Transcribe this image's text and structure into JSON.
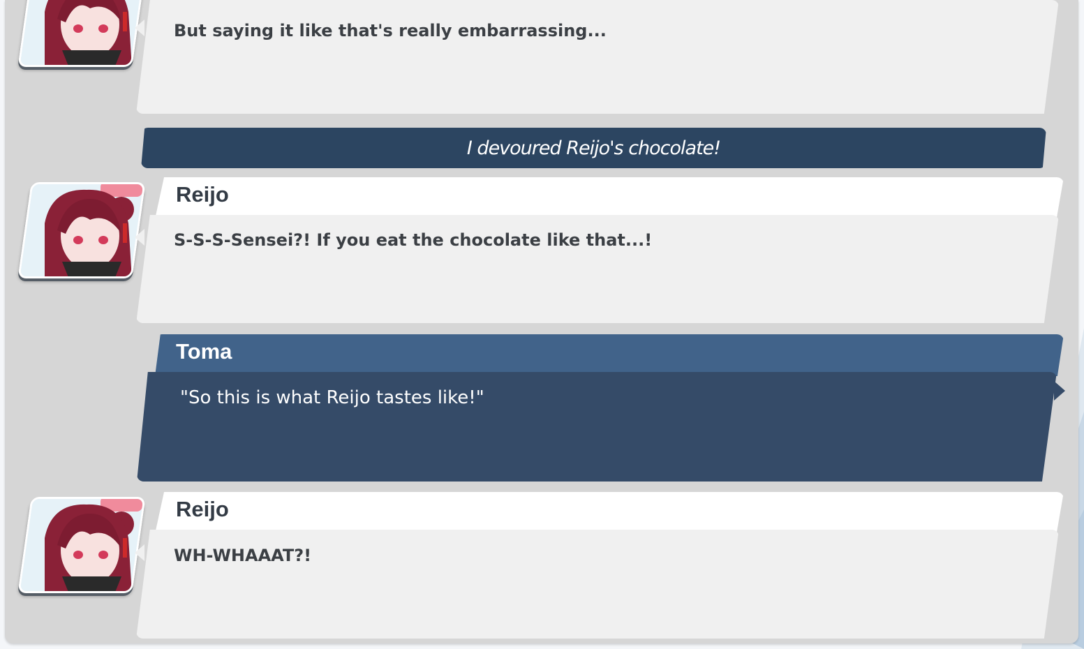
{
  "log": [
    {
      "type": "character",
      "speaker": "",
      "text": "But saying it like that's really embarrassing...",
      "avatar": "reijo-portrait"
    },
    {
      "type": "event",
      "text": "I devoured Reijo's chocolate!"
    },
    {
      "type": "character",
      "speaker": "Reijo",
      "text": "S-S-S-Sensei?! If you eat the chocolate like that...!",
      "avatar": "reijo-portrait"
    },
    {
      "type": "player",
      "speaker": "Toma",
      "text": "\"So this is what Reijo tastes like!\""
    },
    {
      "type": "character",
      "speaker": "Reijo",
      "text": "WH-WHAAAT?!",
      "avatar": "reijo-portrait"
    }
  ],
  "colors": {
    "panel": "#d6d6d6",
    "bubble": "#f0f0f0",
    "event_bar": "#2c4561",
    "player_name_bar": "#41638a",
    "player_bubble": "#354b68"
  }
}
